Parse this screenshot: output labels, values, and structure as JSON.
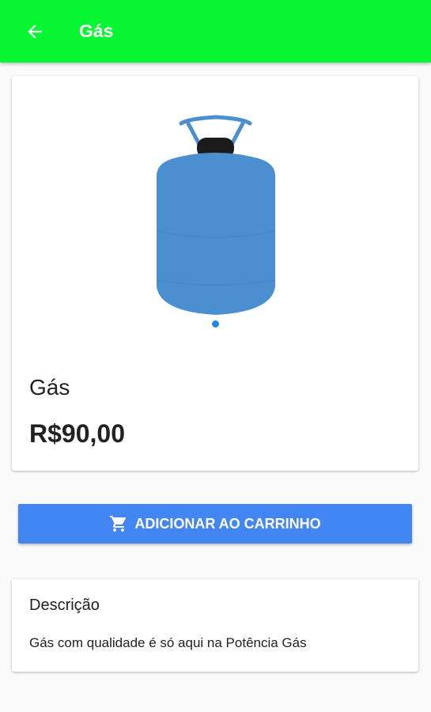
{
  "colors": {
    "appbar": "#06f632",
    "accent": "#4286f4",
    "dot": "#1e88e5",
    "cylinder": "#4b8fd0",
    "valve": "#1c1c1c"
  },
  "appbar": {
    "title": "Gás",
    "back_icon": "arrow-left-icon"
  },
  "product": {
    "image_icon": "gas-cylinder-icon",
    "carousel_pages": 1,
    "carousel_active": 1,
    "name": "Gás",
    "price": "R$90,00"
  },
  "actions": {
    "add_to_cart_label": "ADICIONAR AO CARRINHO",
    "add_to_cart_icon": "cart-icon"
  },
  "description": {
    "title": "Descrição",
    "text": "Gás com qualidade é só aqui na Potência Gás"
  }
}
